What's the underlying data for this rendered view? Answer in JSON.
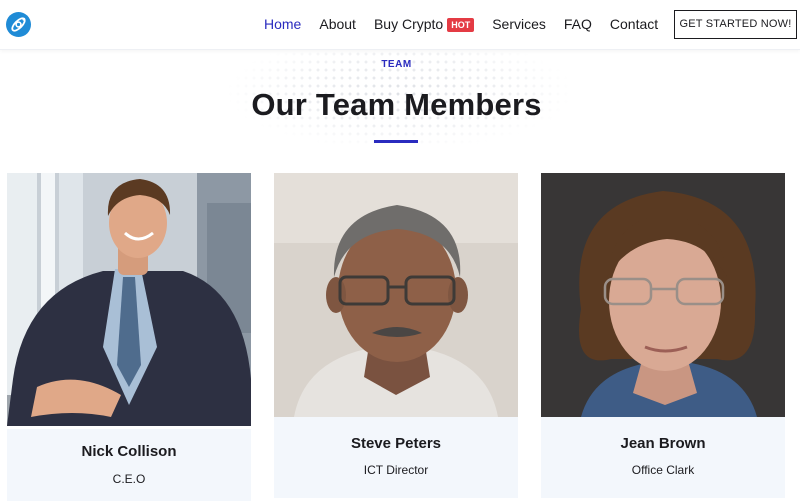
{
  "header": {
    "nav": [
      {
        "label": "Home",
        "active": true
      },
      {
        "label": "About"
      },
      {
        "label": "Buy Crypto",
        "badge": "HOT"
      },
      {
        "label": "Services"
      },
      {
        "label": "FAQ"
      },
      {
        "label": "Contact"
      }
    ],
    "cta_label": "GET STARTED NOW!"
  },
  "section": {
    "eyebrow": "TEAM",
    "title": "Our Team Members"
  },
  "team": [
    {
      "name": "Nick Collison",
      "role": "C.E.O"
    },
    {
      "name": "Steve Peters",
      "role": "ICT Director"
    },
    {
      "name": "Jean Brown",
      "role": "Office Clark"
    }
  ],
  "colors": {
    "accent": "#2a2bbf",
    "hot_badge": "#e43b44",
    "logo": "#1f8bd6",
    "card_info_bg": "#f3f7fc",
    "text": "#1b1b1f"
  },
  "icons": {
    "logo": "orbit-logo-icon"
  }
}
